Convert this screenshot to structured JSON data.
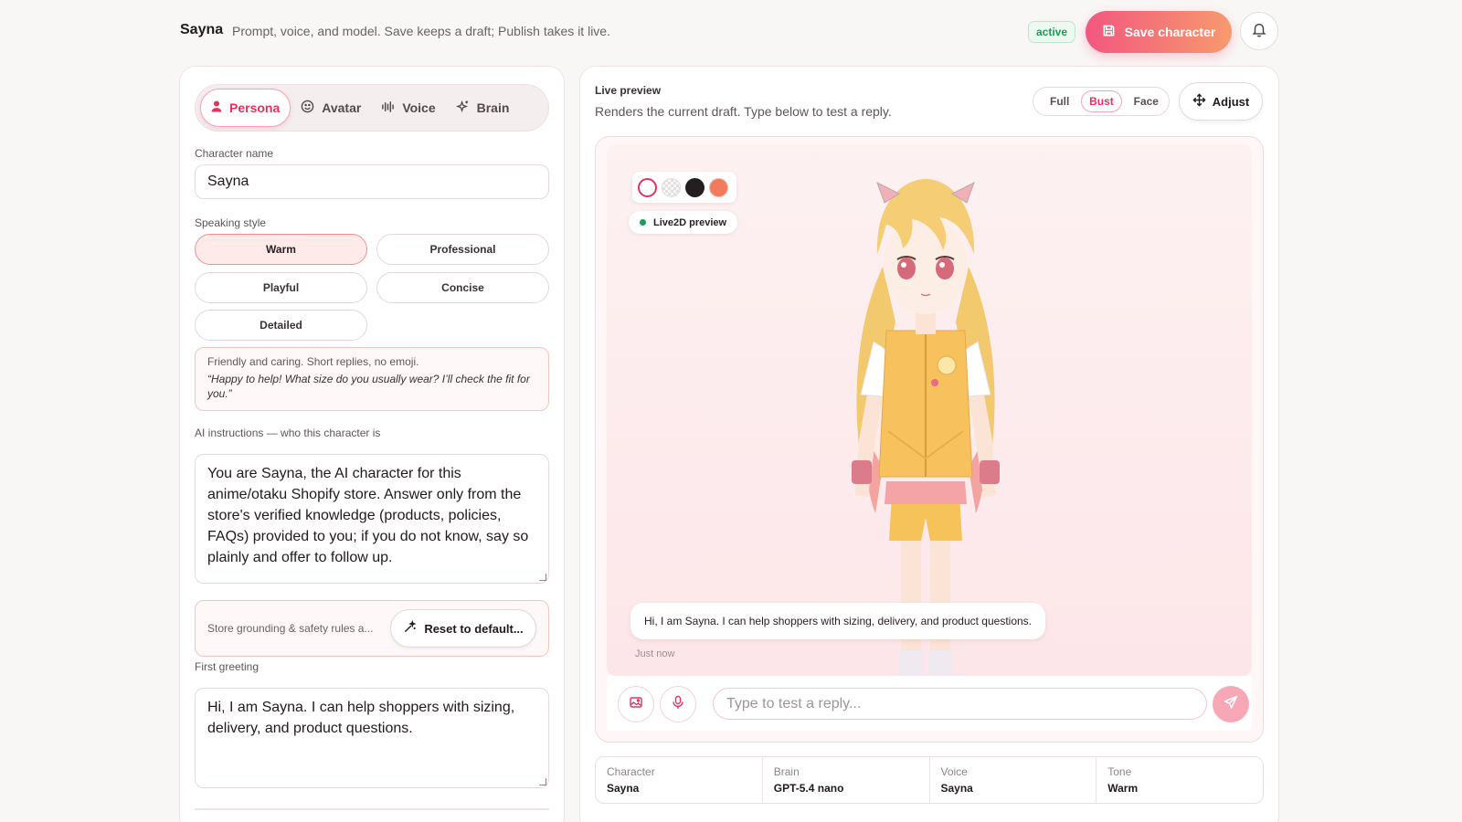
{
  "header": {
    "title": "Sayna",
    "description": "Prompt, voice, and model. Save keeps a draft; Publish takes it live.",
    "status": "active",
    "save_label": "Save character"
  },
  "editor": {
    "tabs": [
      {
        "label": "Persona",
        "icon": "person-icon",
        "active": true
      },
      {
        "label": "Avatar",
        "icon": "smiley-icon",
        "active": false
      },
      {
        "label": "Voice",
        "icon": "waveform-icon",
        "active": false
      },
      {
        "label": "Brain",
        "icon": "sparkle-icon",
        "active": false
      }
    ],
    "name_label": "Character name",
    "name_value": "Sayna",
    "style_label": "Speaking style",
    "styles": [
      {
        "label": "Warm",
        "selected": true
      },
      {
        "label": "Professional",
        "selected": false
      },
      {
        "label": "Playful",
        "selected": false
      },
      {
        "label": "Concise",
        "selected": false
      },
      {
        "label": "Detailed",
        "selected": false
      }
    ],
    "style_hint": "Friendly and caring. Short replies, no emoji.",
    "style_example": "“Happy to help! What size do you usually wear? I’ll check the fit for you.”",
    "instructions_label": "AI instructions — who this character is",
    "instructions_value": "You are Sayna, the AI character for this anime/otaku Shopify store. Answer only from the store's verified knowledge (products, policies, FAQs) provided to you; if you do not know, say so plainly and offer to follow up.",
    "grounding_text": "Store grounding & safety rules a...",
    "reset_label": "Reset to default...",
    "greeting_label": "First greeting",
    "greeting_value": "Hi, I am Sayna. I can help shoppers with sizing, delivery, and product questions."
  },
  "preview": {
    "title": "Live preview",
    "description": "Renders the current draft. Type below to test a reply.",
    "framing": [
      {
        "label": "Full",
        "selected": false
      },
      {
        "label": "Bust",
        "selected": true
      },
      {
        "label": "Face",
        "selected": false
      }
    ],
    "adjust_label": "Adjust",
    "swatch_colors": [
      "#ffffff",
      "#e9e5e6",
      "#231f20",
      "#f27a5e"
    ],
    "live_badge": "Live2D preview",
    "chat_message": "Hi, I am Sayna. I can help shoppers with sizing, delivery, and product questions.",
    "chat_time": "Just now",
    "reply_placeholder": "Type to test a reply...",
    "summary": [
      {
        "label": "Character",
        "value": "Sayna"
      },
      {
        "label": "Brain",
        "value": "GPT-5.4 nano"
      },
      {
        "label": "Voice",
        "value": "Sayna"
      },
      {
        "label": "Tone",
        "value": "Warm"
      }
    ]
  },
  "colors": {
    "accent": "#e0335f",
    "gradient_start": "#f2577f",
    "gradient_end": "#f79a6e",
    "status_green": "#1f9d55"
  }
}
